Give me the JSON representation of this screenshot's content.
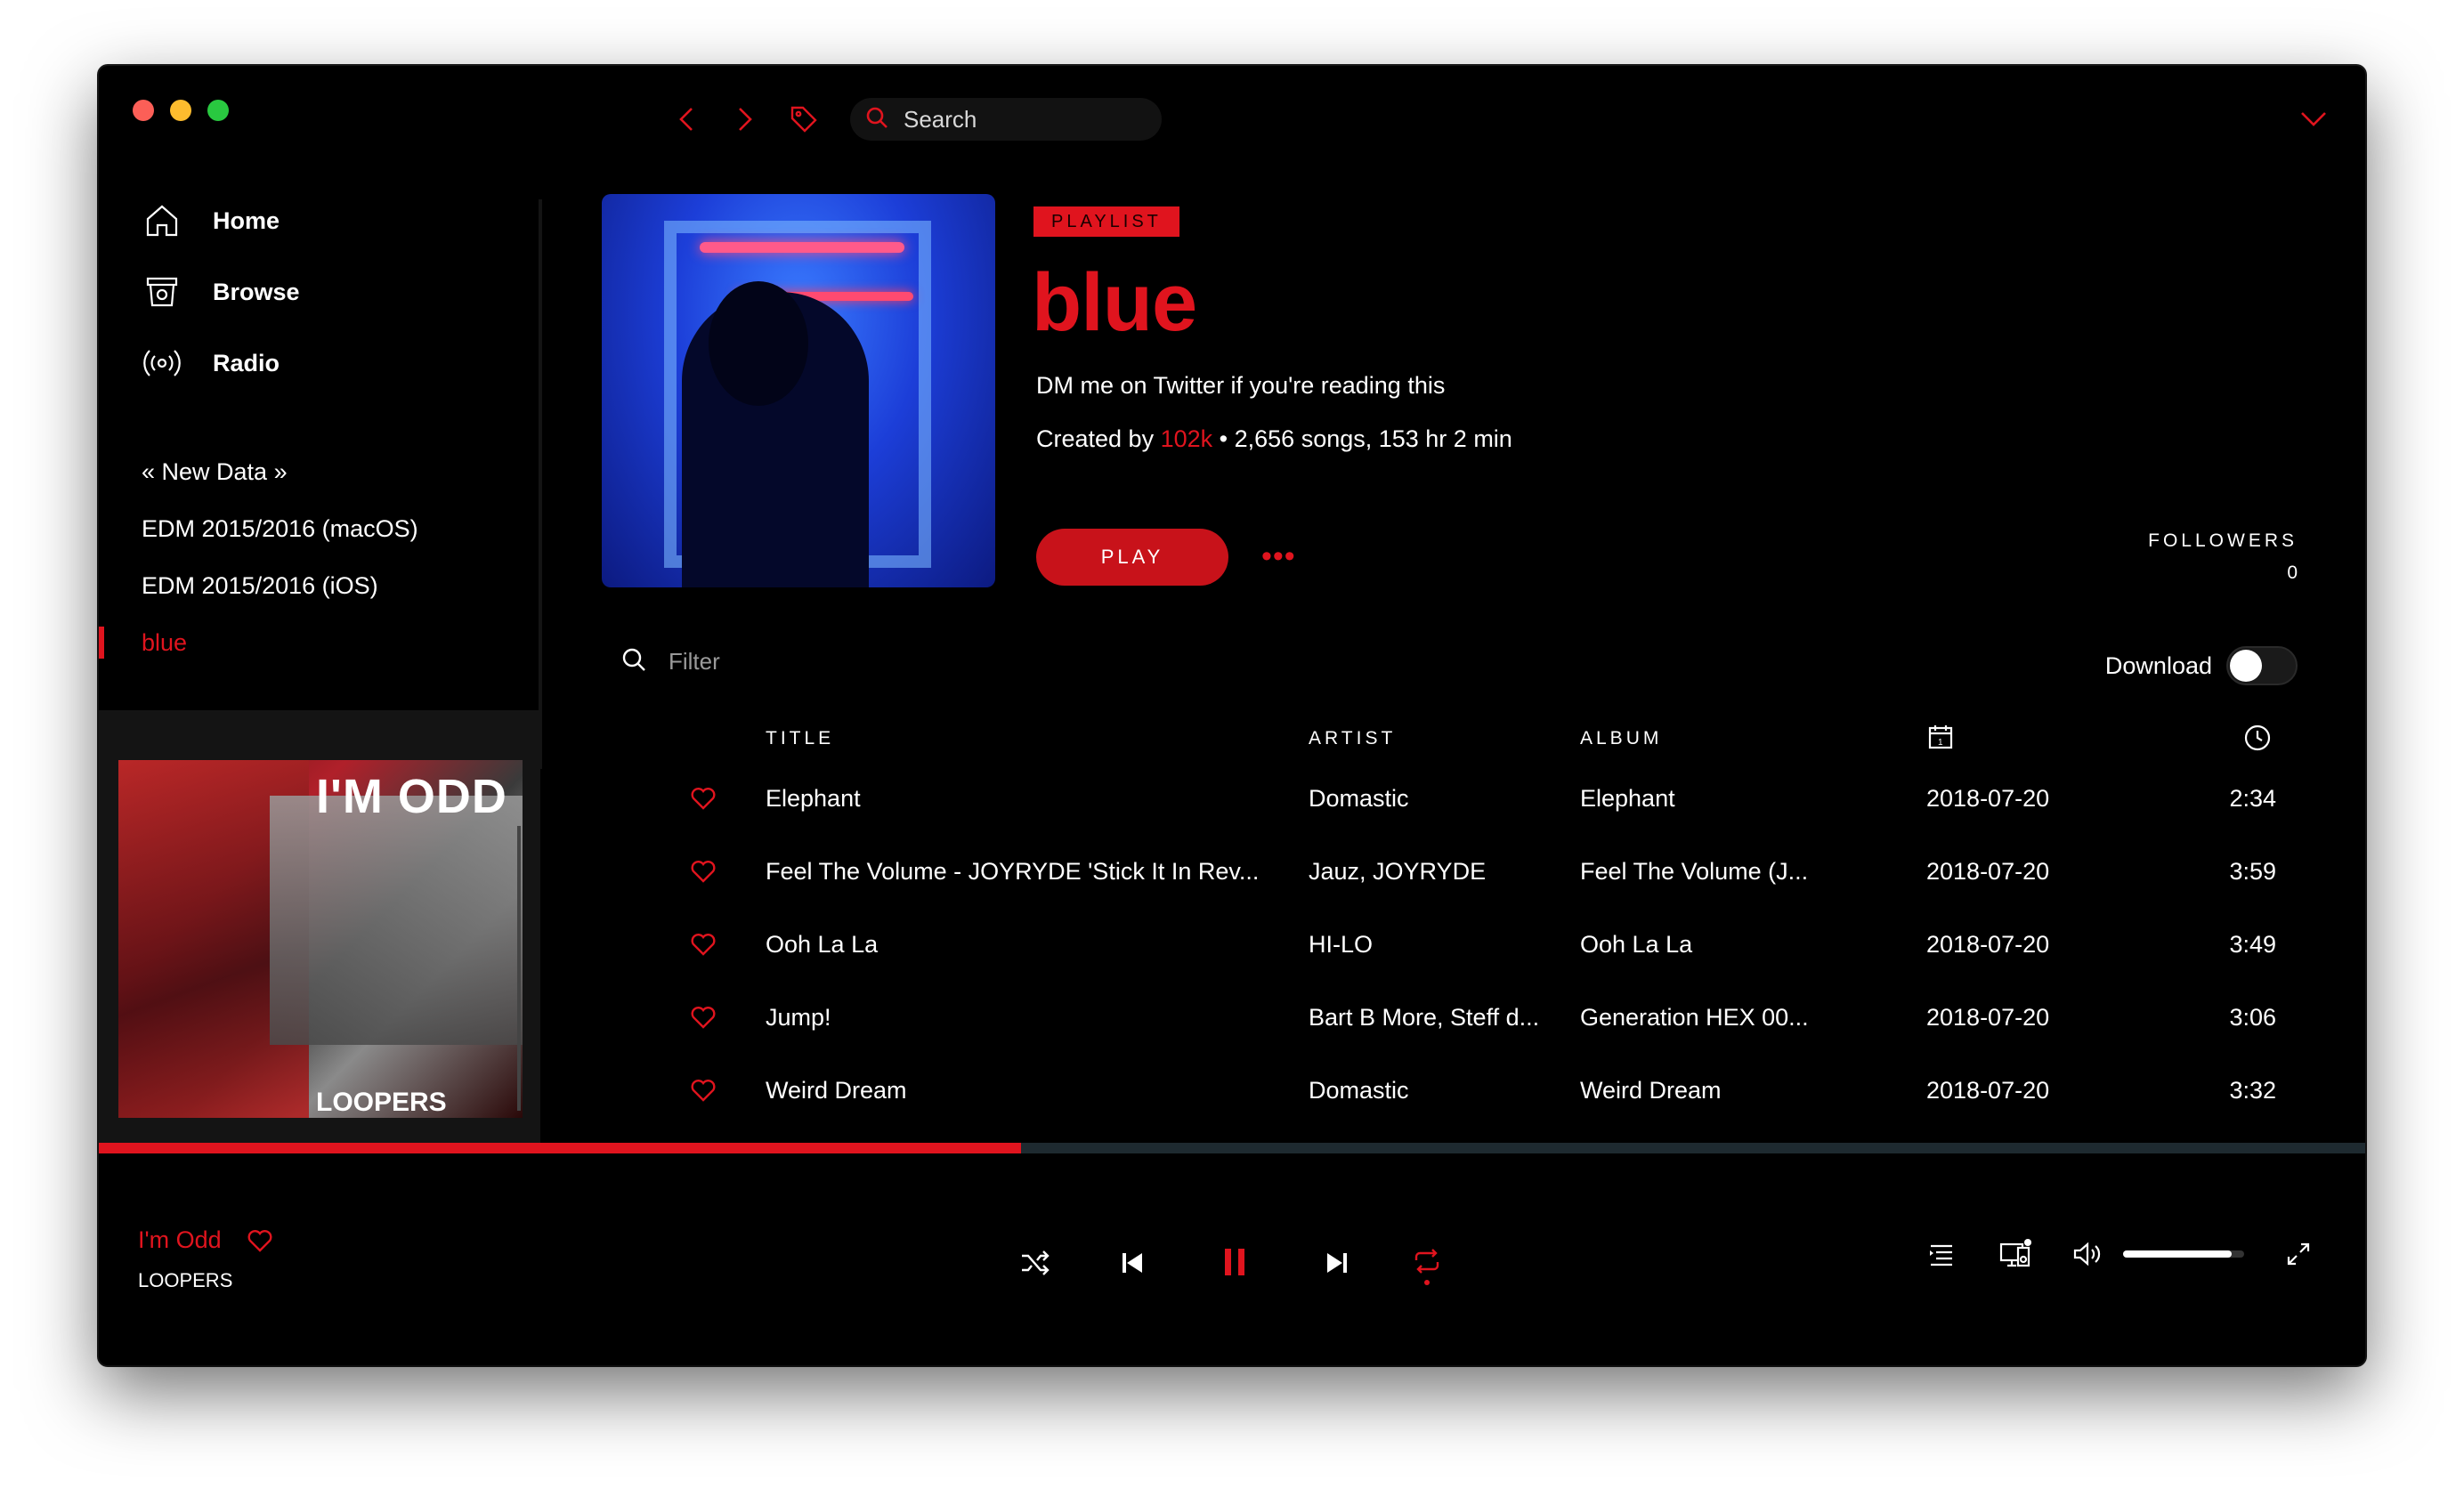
{
  "colors": {
    "accent": "#e0141e",
    "background": "#000000",
    "sidebar_art_bg": "#141414"
  },
  "window": {
    "traffic_lights": [
      "close",
      "minimize",
      "zoom"
    ]
  },
  "sidebar": {
    "nav": [
      {
        "label": "Home",
        "icon": "home-icon"
      },
      {
        "label": "Browse",
        "icon": "browse-icon"
      },
      {
        "label": "Radio",
        "icon": "radio-icon"
      }
    ],
    "playlists": [
      {
        "label": "« New Data »"
      },
      {
        "label": "EDM 2015/2016 (macOS)"
      },
      {
        "label": "EDM 2015/2016 (iOS)"
      },
      {
        "label": "blue",
        "active": true
      }
    ],
    "now_playing_art": {
      "title": "I'M ODD",
      "label": "LOOPERS",
      "badge": "ODD"
    }
  },
  "topbar": {
    "search_placeholder": "Search",
    "icons": [
      "back-icon",
      "forward-icon",
      "tag-icon",
      "search-icon",
      "collapse-icon"
    ]
  },
  "playlist": {
    "type_badge": "PLAYLIST",
    "title": "blue",
    "description": "DM me on Twitter if you're reading this",
    "created_by_prefix": "Created by",
    "owner": "102k",
    "stats": "• 2,656 songs, 153 hr 2 min",
    "play_label": "PLAY",
    "more_label": "•••",
    "followers_label": "FOLLOWERS",
    "followers_count": "0",
    "filter_placeholder": "Filter",
    "download_label": "Download",
    "download_enabled": false
  },
  "table": {
    "headers": {
      "title": "TITLE",
      "artist": "ARTIST",
      "album": "ALBUM",
      "date_icon": "calendar-icon",
      "duration_icon": "clock-icon"
    },
    "rows": [
      {
        "title": "Elephant",
        "artist": "Domastic",
        "album": "Elephant",
        "date": "2018-07-20",
        "duration": "2:34"
      },
      {
        "title": "Feel The Volume - JOYRYDE 'Stick It In Rev...",
        "artist": "Jauz, JOYRYDE",
        "album": "Feel The Volume (J...",
        "date": "2018-07-20",
        "duration": "3:59"
      },
      {
        "title": "Ooh La La",
        "artist": "HI-LO",
        "album": "Ooh La La",
        "date": "2018-07-20",
        "duration": "3:49"
      },
      {
        "title": "Jump!",
        "artist": "Bart B More, Steff d...",
        "album": "Generation HEX 00...",
        "date": "2018-07-20",
        "duration": "3:06"
      },
      {
        "title": "Weird Dream",
        "artist": "Domastic",
        "album": "Weird Dream",
        "date": "2018-07-20",
        "duration": "3:32"
      }
    ]
  },
  "player": {
    "track": "I'm Odd",
    "artist": "LOOPERS",
    "progress": 0.407,
    "volume": 0.9,
    "state": "playing",
    "repeat": true
  }
}
